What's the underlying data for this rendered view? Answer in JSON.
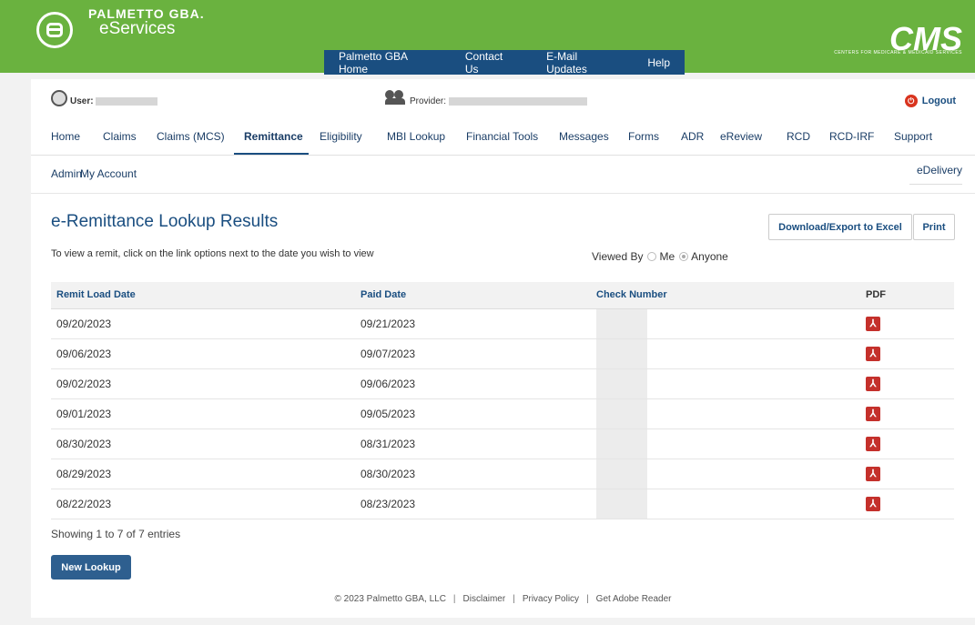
{
  "brand": {
    "top": "PALMETTO GBA.",
    "name": "eServices",
    "cms": "CMS",
    "cms_sub": "CENTERS FOR MEDICARE & MEDICAID SERVICES"
  },
  "topnav": [
    "Palmetto GBA Home",
    "Contact Us",
    "E-Mail Updates",
    "Help"
  ],
  "userbar": {
    "user_label": "User:",
    "provider_label": "Provider:",
    "logout": "Logout"
  },
  "mainnav": [
    "Home",
    "Claims",
    "Claims (MCS)",
    "Remittance",
    "Eligibility",
    "MBI Lookup",
    "Financial Tools",
    "Messages",
    "Forms",
    "ADR",
    "eReview",
    "RCD",
    "RCD-IRF",
    "Support"
  ],
  "subnav": [
    "Admin",
    "My Account"
  ],
  "edelivery": "eDelivery",
  "page": {
    "title": "e-Remittance Lookup Results",
    "instructions": "To view a remit, click on the link options next to the date you wish to view",
    "viewed_by": "Viewed By",
    "opt_me": "Me",
    "opt_anyone": "Anyone",
    "btn_excel": "Download/Export to Excel",
    "btn_print": "Print"
  },
  "table": {
    "headers": [
      "Remit Load Date",
      "Paid Date",
      "Check Number",
      "PDF"
    ],
    "rows": [
      {
        "remit": "09/20/2023",
        "paid": "09/21/2023"
      },
      {
        "remit": "09/06/2023",
        "paid": "09/07/2023"
      },
      {
        "remit": "09/02/2023",
        "paid": "09/06/2023"
      },
      {
        "remit": "09/01/2023",
        "paid": "09/05/2023"
      },
      {
        "remit": "08/30/2023",
        "paid": "08/31/2023"
      },
      {
        "remit": "08/29/2023",
        "paid": "08/30/2023"
      },
      {
        "remit": "08/22/2023",
        "paid": "08/23/2023"
      }
    ]
  },
  "showing": "Showing 1 to 7 of 7 entries",
  "btn_new": "New Lookup",
  "footer": [
    "© 2023 Palmetto GBA, LLC",
    "Disclaimer",
    "Privacy Policy",
    "Get Adobe Reader"
  ]
}
